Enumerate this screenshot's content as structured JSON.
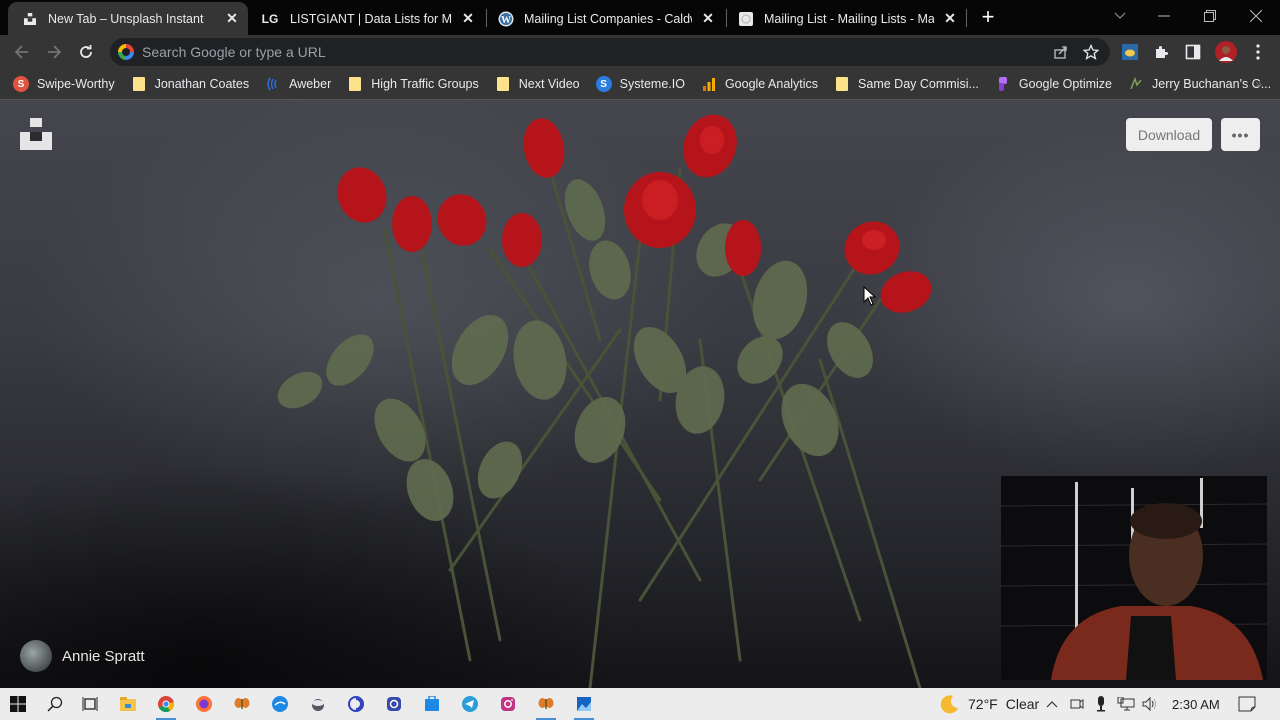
{
  "browser": {
    "tabs": [
      {
        "title": "New Tab – Unsplash Instant",
        "favicon": "unsplash-icon",
        "active": true
      },
      {
        "title": "LISTGIANT | Data Lists for Marketers",
        "favicon": "listgiant-icon",
        "active": false,
        "favicon_text": "LG"
      },
      {
        "title": "Mailing List Companies - Caldwell",
        "favicon": "wordpress-icon",
        "active": false
      },
      {
        "title": "Mailing List - Mailing Lists - Mailing",
        "favicon": "page-icon",
        "active": false
      }
    ],
    "new_tab_label": "+",
    "window_controls": {
      "tab_search": "⌄",
      "minimize": "—",
      "restore": "❐",
      "close": "✕"
    },
    "omnibox": {
      "placeholder": "Search Google or type a URL",
      "value": ""
    },
    "bookmarks": [
      {
        "label": "Swipe-Worthy",
        "icon": "swipe-worthy-icon",
        "icon_color": "#e0533e",
        "icon_text": "S"
      },
      {
        "label": "Jonathan Coates",
        "icon": "folder-icon"
      },
      {
        "label": "Aweber",
        "icon": "aweber-icon",
        "icon_color": "#2d6bd6"
      },
      {
        "label": "High Traffic Groups",
        "icon": "folder-icon"
      },
      {
        "label": "Next Video",
        "icon": "folder-icon"
      },
      {
        "label": "Systeme.IO",
        "icon": "systeme-icon",
        "icon_color": "#2a7de1",
        "icon_text": "S"
      },
      {
        "label": "Google Analytics",
        "icon": "analytics-icon",
        "icon_color": "#f9ab00"
      },
      {
        "label": "Same Day Commisi...",
        "icon": "folder-icon"
      },
      {
        "label": "Google Optimize",
        "icon": "optimize-icon",
        "icon_color": "#a142f4"
      },
      {
        "label": "Jerry Buchanan's C...",
        "icon": "page-icon",
        "icon_color": "#6a8a4a"
      }
    ],
    "bookmarks_more": "»"
  },
  "page": {
    "download_label": "Download",
    "more_label": "•••",
    "photographer": "Annie Spratt"
  },
  "taskbar": {
    "apps": [
      "windows-start",
      "search",
      "task-view",
      "file-explorer",
      "chrome",
      "firefox",
      "butterfly-app",
      "app-blue",
      "app-globe",
      "app-circle",
      "app-circle-2",
      "app-store",
      "telegram",
      "instagram",
      "butterfly-app-2",
      "photos"
    ],
    "weather": {
      "temp": "72°F",
      "condition": "Clear"
    },
    "time": "2:30 AM"
  },
  "colors": {
    "tab_active": "#353535",
    "tabstrip": "#060606",
    "rose_red": "#b5141a",
    "leaf_green": "#5f6b4e"
  }
}
